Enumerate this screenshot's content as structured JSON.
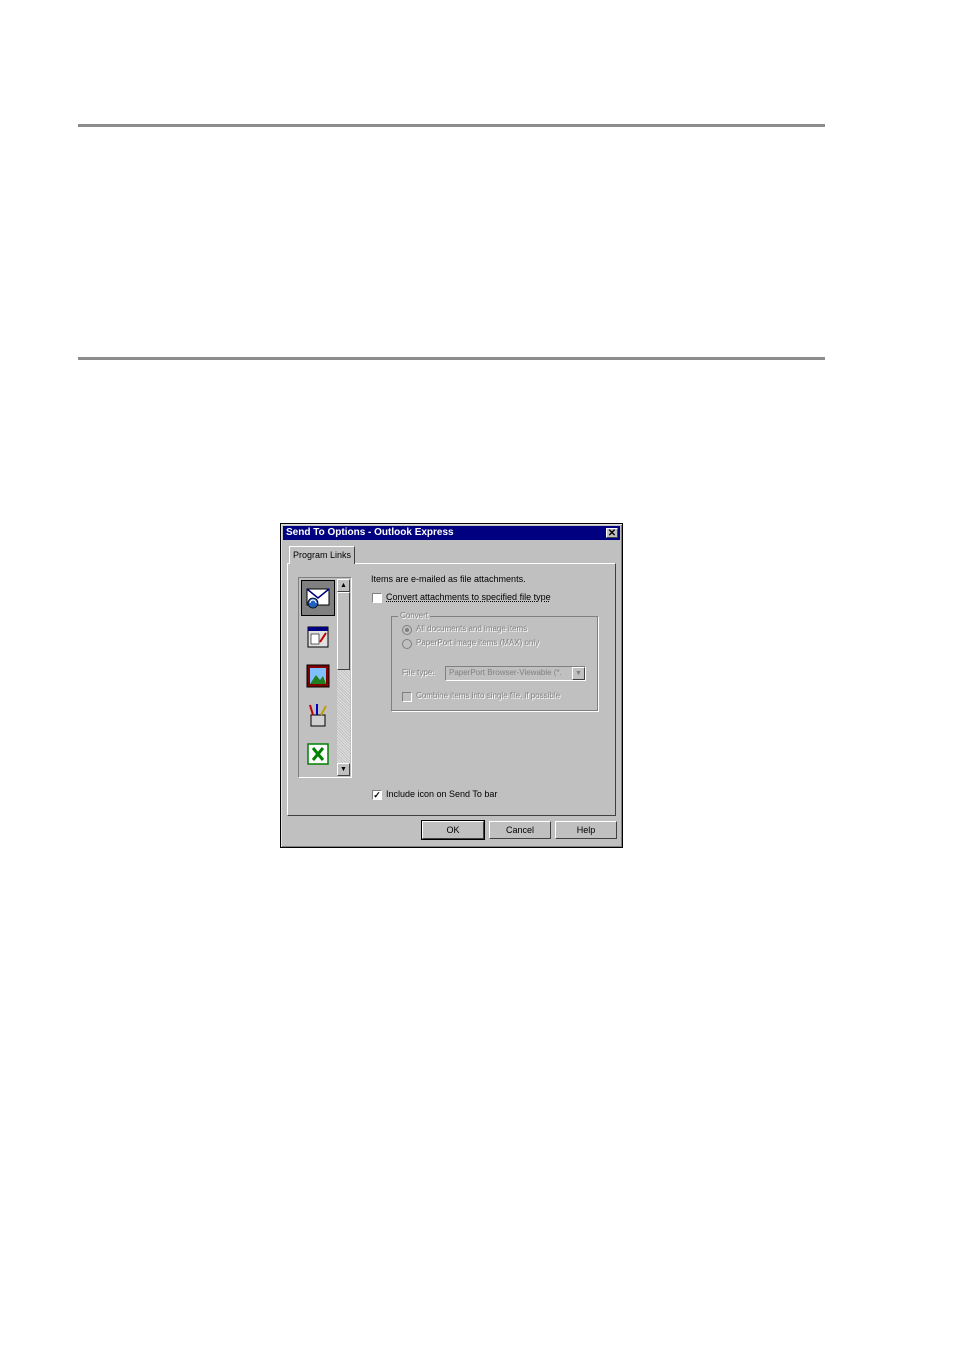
{
  "dialog": {
    "title": "Send To Options - Outlook Express",
    "close_label": "✕",
    "tab_label": "Program Links",
    "info_text": "Items are e-mailed as file attachments.",
    "convert_label": "Convert attachments to specified file type",
    "group_label": "Convert",
    "radio_all_label": "All documents and image items",
    "radio_max_label": "PaperPort image items (MAX) only",
    "file_type_label": "File type:",
    "file_type_value": "PaperPort Browser-Viewable (*.",
    "combine_label": "Combine items into single file, if possible",
    "include_icon_label": "Include icon on Send To bar",
    "include_icon_checked": "✓",
    "buttons": {
      "ok": "OK",
      "cancel": "Cancel",
      "help": "Help"
    },
    "program_icons": [
      "outlook-express-icon",
      "pagemanager-icon",
      "image-viewer-icon",
      "paint-icon",
      "excel-icon"
    ]
  }
}
